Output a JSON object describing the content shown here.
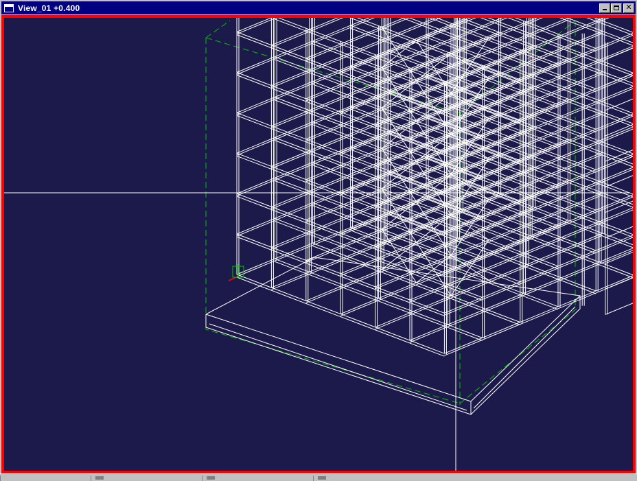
{
  "window": {
    "title": "View_01 +0.400",
    "buttons": {
      "minimize": "minimize-icon",
      "maximize": "maximize-icon",
      "close": "close-icon"
    }
  },
  "viewport": {
    "background_color": "#1c1a4b",
    "border_color": "#ff0000",
    "model_color": "#ffffff",
    "bounding_box_color": "#00c000",
    "axis_colors": {
      "x": "#ff0000",
      "y": "#00c000"
    }
  },
  "statusbar": {
    "panes": [
      {
        "name": "status-pane-1",
        "icon": ""
      },
      {
        "name": "status-pane-2",
        "icon": "grid-icon"
      },
      {
        "name": "status-pane-3",
        "icon": "layer-icon"
      },
      {
        "name": "status-pane-4",
        "icon": "layer-icon"
      }
    ]
  }
}
